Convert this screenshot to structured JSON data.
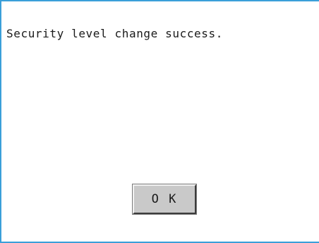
{
  "dialog": {
    "message": "Security level change success.",
    "ok_label": "O K",
    "accent_color": "#3a9fd9"
  }
}
